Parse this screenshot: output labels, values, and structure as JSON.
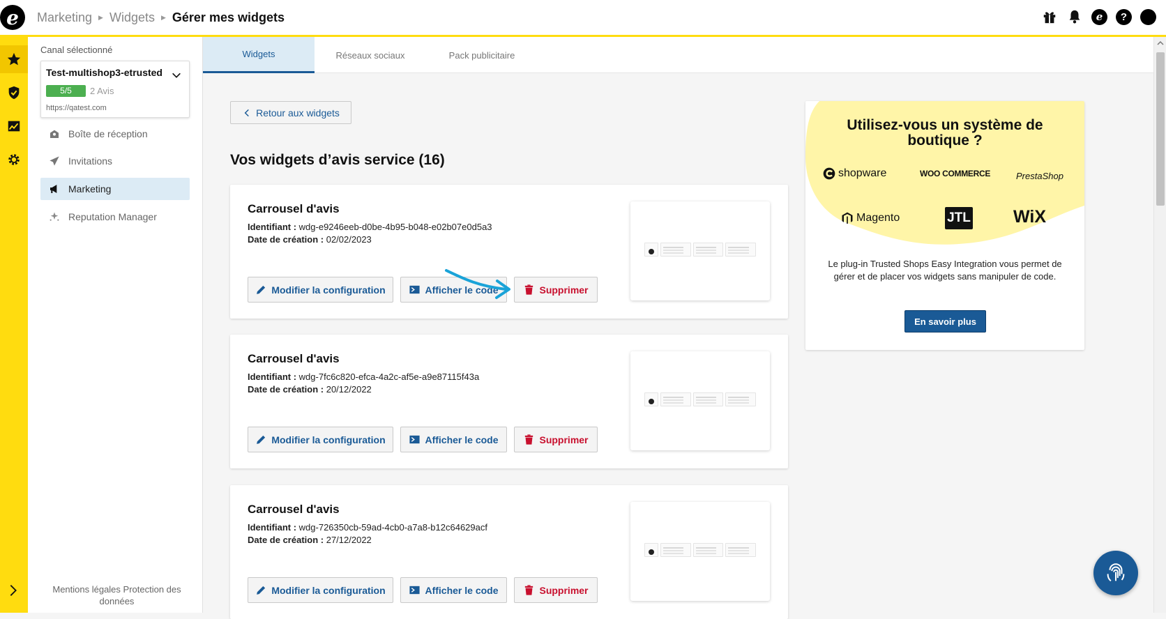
{
  "app": {
    "logo_letter": "e",
    "breadcrumb": [
      "Marketing",
      "Widgets"
    ],
    "breadcrumb_current": "Gérer mes widgets"
  },
  "top_icons": [
    "gift-icon",
    "bell-icon",
    "etrusted-icon",
    "help-icon",
    "profile-icon"
  ],
  "rail": {
    "items": [
      "star-icon",
      "shield-check-icon",
      "chart-icon",
      "gear-icon"
    ],
    "expand_icon": "chevron-right-icon"
  },
  "sidebar": {
    "channel_label": "Canal sélectionné",
    "channel": {
      "name": "Test-multishop3-etrusted",
      "score": "5/5",
      "reviews": "2 Avis",
      "url": "https://qatest.com"
    },
    "items": [
      {
        "label": "Boîte de réception",
        "icon": "inbox-icon"
      },
      {
        "label": "Invitations",
        "icon": "paper-plane-icon"
      },
      {
        "label": "Marketing",
        "icon": "megaphone-icon"
      },
      {
        "label": "Reputation Manager",
        "icon": "sparkles-icon"
      }
    ],
    "footer": "Mentions légales     Protection des données"
  },
  "tabs": [
    {
      "label": "Widgets",
      "active": true
    },
    {
      "label": "Réseaux sociaux",
      "active": false
    },
    {
      "label": "Pack publicitaire",
      "active": false
    }
  ],
  "main": {
    "back_label": "Retour aux widgets",
    "section_title": "Vos widgets d’avis service (16)",
    "id_label": "Identifiant :",
    "date_label": "Date de création :",
    "edit_label": "Modifier la configuration",
    "code_label": "Afficher le code",
    "delete_label": "Supprimer",
    "widgets": [
      {
        "title": "Carrousel d'avis",
        "id": "wdg-e9246eeb-d0be-4b95-b048-e02b07e0d5a3",
        "date": "02/02/2023"
      },
      {
        "title": "Carrousel d'avis",
        "id": "wdg-7fc6c820-efca-4a2c-af5e-a9e87115f43a",
        "date": "20/12/2022"
      },
      {
        "title": "Carrousel d'avis",
        "id": "wdg-726350cb-59ad-4cb0-a7a8-b12c64629acf",
        "date": "27/12/2022"
      }
    ]
  },
  "promo": {
    "title": "Utilisez-vous un système de boutique ?",
    "brands": [
      "shopware",
      "WOO COMMERCE",
      "PrestaShop",
      "Magento",
      "JTL",
      "WiX"
    ],
    "text": "Le plug-in Trusted Shops Easy Integration vous permet de gérer et de placer vos widgets sans manipuler de code.",
    "button": "En savoir plus",
    "blob_color": "#fff5a8"
  },
  "colors": {
    "accent_yellow": "#ffdc0f",
    "primary_blue": "#1a5a96",
    "delete_red": "#c8102e",
    "score_green": "#4caf50"
  }
}
